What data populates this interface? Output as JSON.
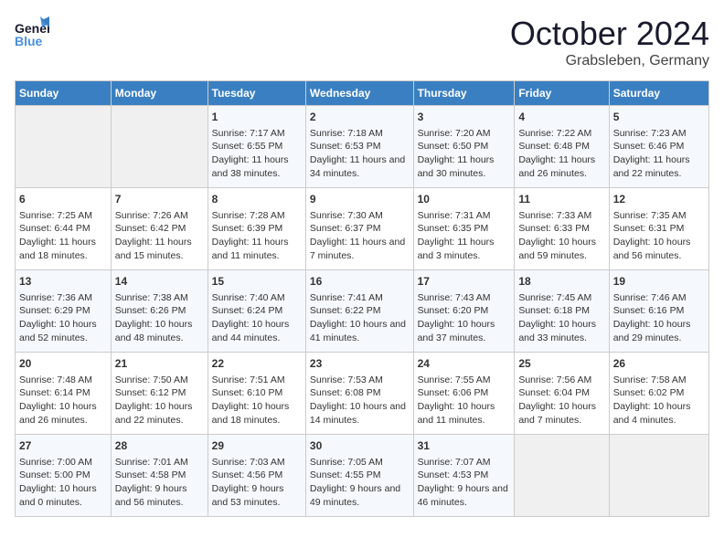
{
  "header": {
    "logo_general": "General",
    "logo_blue": "Blue",
    "month": "October 2024",
    "location": "Grabsleben, Germany"
  },
  "weekdays": [
    "Sunday",
    "Monday",
    "Tuesday",
    "Wednesday",
    "Thursday",
    "Friday",
    "Saturday"
  ],
  "weeks": [
    [
      {
        "day": "",
        "sunrise": "",
        "sunset": "",
        "daylight": ""
      },
      {
        "day": "",
        "sunrise": "",
        "sunset": "",
        "daylight": ""
      },
      {
        "day": "1",
        "sunrise": "Sunrise: 7:17 AM",
        "sunset": "Sunset: 6:55 PM",
        "daylight": "Daylight: 11 hours and 38 minutes."
      },
      {
        "day": "2",
        "sunrise": "Sunrise: 7:18 AM",
        "sunset": "Sunset: 6:53 PM",
        "daylight": "Daylight: 11 hours and 34 minutes."
      },
      {
        "day": "3",
        "sunrise": "Sunrise: 7:20 AM",
        "sunset": "Sunset: 6:50 PM",
        "daylight": "Daylight: 11 hours and 30 minutes."
      },
      {
        "day": "4",
        "sunrise": "Sunrise: 7:22 AM",
        "sunset": "Sunset: 6:48 PM",
        "daylight": "Daylight: 11 hours and 26 minutes."
      },
      {
        "day": "5",
        "sunrise": "Sunrise: 7:23 AM",
        "sunset": "Sunset: 6:46 PM",
        "daylight": "Daylight: 11 hours and 22 minutes."
      }
    ],
    [
      {
        "day": "6",
        "sunrise": "Sunrise: 7:25 AM",
        "sunset": "Sunset: 6:44 PM",
        "daylight": "Daylight: 11 hours and 18 minutes."
      },
      {
        "day": "7",
        "sunrise": "Sunrise: 7:26 AM",
        "sunset": "Sunset: 6:42 PM",
        "daylight": "Daylight: 11 hours and 15 minutes."
      },
      {
        "day": "8",
        "sunrise": "Sunrise: 7:28 AM",
        "sunset": "Sunset: 6:39 PM",
        "daylight": "Daylight: 11 hours and 11 minutes."
      },
      {
        "day": "9",
        "sunrise": "Sunrise: 7:30 AM",
        "sunset": "Sunset: 6:37 PM",
        "daylight": "Daylight: 11 hours and 7 minutes."
      },
      {
        "day": "10",
        "sunrise": "Sunrise: 7:31 AM",
        "sunset": "Sunset: 6:35 PM",
        "daylight": "Daylight: 11 hours and 3 minutes."
      },
      {
        "day": "11",
        "sunrise": "Sunrise: 7:33 AM",
        "sunset": "Sunset: 6:33 PM",
        "daylight": "Daylight: 10 hours and 59 minutes."
      },
      {
        "day": "12",
        "sunrise": "Sunrise: 7:35 AM",
        "sunset": "Sunset: 6:31 PM",
        "daylight": "Daylight: 10 hours and 56 minutes."
      }
    ],
    [
      {
        "day": "13",
        "sunrise": "Sunrise: 7:36 AM",
        "sunset": "Sunset: 6:29 PM",
        "daylight": "Daylight: 10 hours and 52 minutes."
      },
      {
        "day": "14",
        "sunrise": "Sunrise: 7:38 AM",
        "sunset": "Sunset: 6:26 PM",
        "daylight": "Daylight: 10 hours and 48 minutes."
      },
      {
        "day": "15",
        "sunrise": "Sunrise: 7:40 AM",
        "sunset": "Sunset: 6:24 PM",
        "daylight": "Daylight: 10 hours and 44 minutes."
      },
      {
        "day": "16",
        "sunrise": "Sunrise: 7:41 AM",
        "sunset": "Sunset: 6:22 PM",
        "daylight": "Daylight: 10 hours and 41 minutes."
      },
      {
        "day": "17",
        "sunrise": "Sunrise: 7:43 AM",
        "sunset": "Sunset: 6:20 PM",
        "daylight": "Daylight: 10 hours and 37 minutes."
      },
      {
        "day": "18",
        "sunrise": "Sunrise: 7:45 AM",
        "sunset": "Sunset: 6:18 PM",
        "daylight": "Daylight: 10 hours and 33 minutes."
      },
      {
        "day": "19",
        "sunrise": "Sunrise: 7:46 AM",
        "sunset": "Sunset: 6:16 PM",
        "daylight": "Daylight: 10 hours and 29 minutes."
      }
    ],
    [
      {
        "day": "20",
        "sunrise": "Sunrise: 7:48 AM",
        "sunset": "Sunset: 6:14 PM",
        "daylight": "Daylight: 10 hours and 26 minutes."
      },
      {
        "day": "21",
        "sunrise": "Sunrise: 7:50 AM",
        "sunset": "Sunset: 6:12 PM",
        "daylight": "Daylight: 10 hours and 22 minutes."
      },
      {
        "day": "22",
        "sunrise": "Sunrise: 7:51 AM",
        "sunset": "Sunset: 6:10 PM",
        "daylight": "Daylight: 10 hours and 18 minutes."
      },
      {
        "day": "23",
        "sunrise": "Sunrise: 7:53 AM",
        "sunset": "Sunset: 6:08 PM",
        "daylight": "Daylight: 10 hours and 14 minutes."
      },
      {
        "day": "24",
        "sunrise": "Sunrise: 7:55 AM",
        "sunset": "Sunset: 6:06 PM",
        "daylight": "Daylight: 10 hours and 11 minutes."
      },
      {
        "day": "25",
        "sunrise": "Sunrise: 7:56 AM",
        "sunset": "Sunset: 6:04 PM",
        "daylight": "Daylight: 10 hours and 7 minutes."
      },
      {
        "day": "26",
        "sunrise": "Sunrise: 7:58 AM",
        "sunset": "Sunset: 6:02 PM",
        "daylight": "Daylight: 10 hours and 4 minutes."
      }
    ],
    [
      {
        "day": "27",
        "sunrise": "Sunrise: 7:00 AM",
        "sunset": "Sunset: 5:00 PM",
        "daylight": "Daylight: 10 hours and 0 minutes."
      },
      {
        "day": "28",
        "sunrise": "Sunrise: 7:01 AM",
        "sunset": "Sunset: 4:58 PM",
        "daylight": "Daylight: 9 hours and 56 minutes."
      },
      {
        "day": "29",
        "sunrise": "Sunrise: 7:03 AM",
        "sunset": "Sunset: 4:56 PM",
        "daylight": "Daylight: 9 hours and 53 minutes."
      },
      {
        "day": "30",
        "sunrise": "Sunrise: 7:05 AM",
        "sunset": "Sunset: 4:55 PM",
        "daylight": "Daylight: 9 hours and 49 minutes."
      },
      {
        "day": "31",
        "sunrise": "Sunrise: 7:07 AM",
        "sunset": "Sunset: 4:53 PM",
        "daylight": "Daylight: 9 hours and 46 minutes."
      },
      {
        "day": "",
        "sunrise": "",
        "sunset": "",
        "daylight": ""
      },
      {
        "day": "",
        "sunrise": "",
        "sunset": "",
        "daylight": ""
      }
    ]
  ]
}
